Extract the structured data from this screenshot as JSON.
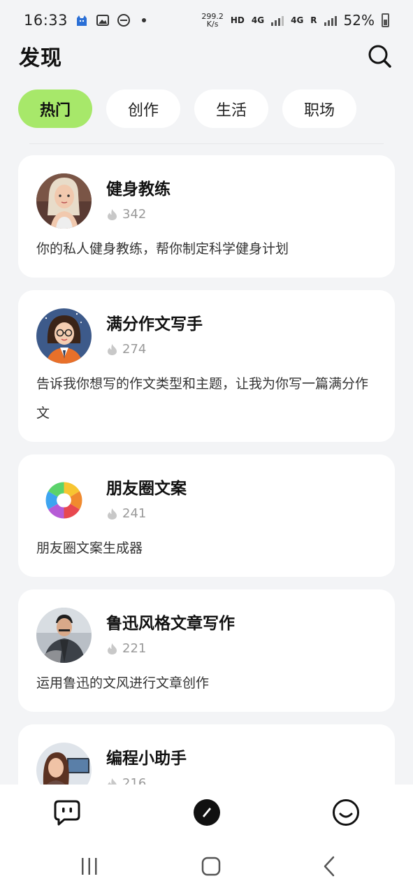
{
  "status_bar": {
    "time": "16:33",
    "net_speed_value": "299.2",
    "net_speed_unit": "K/s",
    "hd": "HD",
    "net1": "4G",
    "net2": "4G",
    "roaming": "R",
    "battery": "52%"
  },
  "header": {
    "title": "发现"
  },
  "tabs": [
    {
      "label": "热门",
      "active": true
    },
    {
      "label": "创作",
      "active": false
    },
    {
      "label": "生活",
      "active": false
    },
    {
      "label": "职场",
      "active": false
    }
  ],
  "cards": [
    {
      "title": "健身教练",
      "count": "342",
      "desc": "你的私人健身教练，帮你制定科学健身计划"
    },
    {
      "title": "满分作文写手",
      "count": "274",
      "desc": "告诉我你想写的作文类型和主题，让我为你写一篇满分作文"
    },
    {
      "title": "朋友圈文案",
      "count": "241",
      "desc": "朋友圈文案生成器"
    },
    {
      "title": "鲁迅风格文章写作",
      "count": "221",
      "desc": "运用鲁迅的文风进行文章创作"
    },
    {
      "title": "编程小助手",
      "count": "216",
      "desc": ""
    }
  ],
  "colors": {
    "accent": "#a7e86a",
    "background": "#f3f4f6"
  },
  "icons": {
    "search": "search-icon",
    "flame": "flame-icon",
    "nav_chat": "chat-bubble-icon",
    "nav_discover": "compass-icon",
    "nav_profile": "smiley-icon"
  }
}
